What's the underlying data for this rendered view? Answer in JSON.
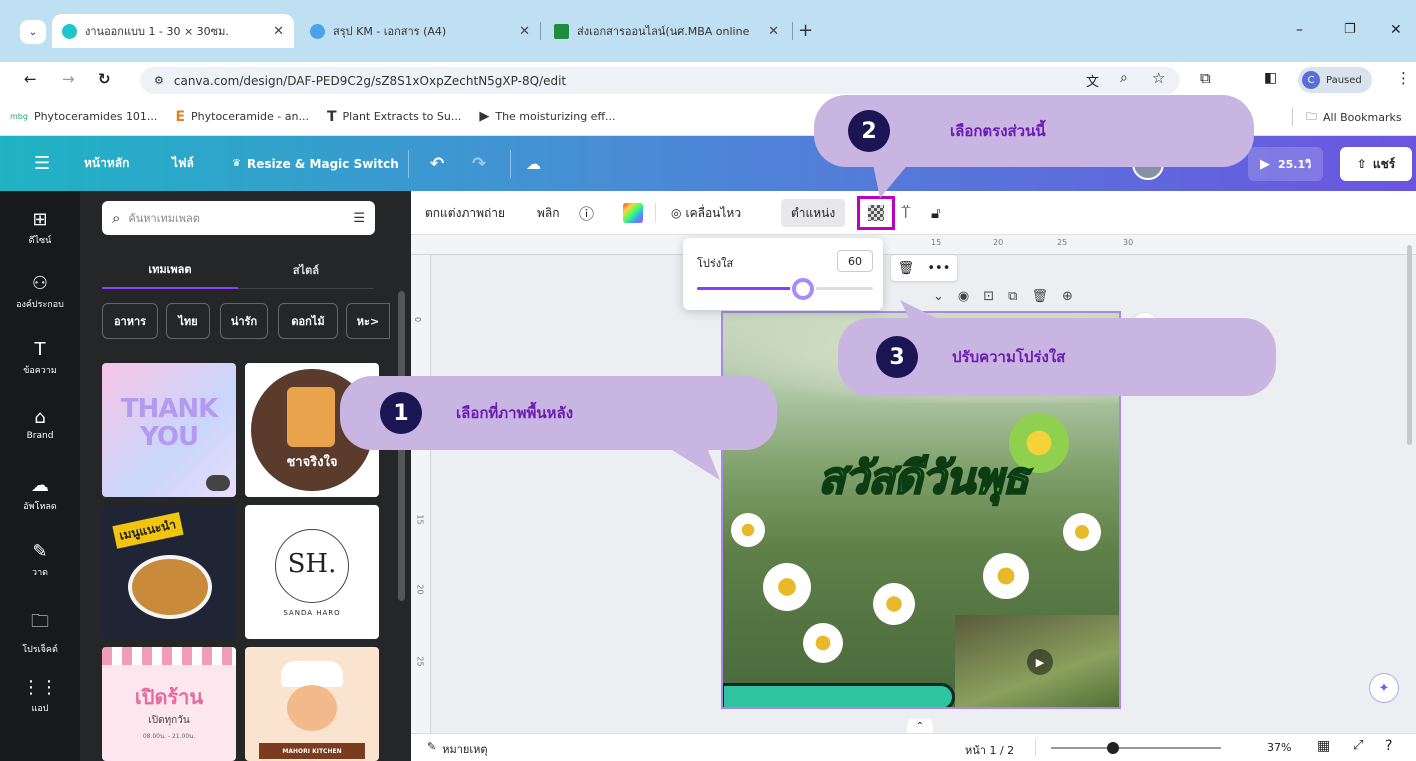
{
  "browser": {
    "tabs": [
      {
        "title": "งานออกแบบ 1 - 30 × 30ซม.",
        "active": true
      },
      {
        "title": "สรุป KM - เอกสาร (A4)",
        "active": false
      },
      {
        "title": "ส่งเอกสารออนไลน์(นศ.MBA online",
        "active": false
      }
    ],
    "url": "canva.com/design/DAF-PED9C2g/sZ8S1xOxpZechtN5gXP-8Q/edit",
    "profile_status": "Paused",
    "bookmarks": [
      "Phytoceramides 101...",
      "Phytoceramide - an...",
      "Plant Extracts to Su...",
      "The moisturizing eff..."
    ],
    "all_bookmarks": "All Bookmarks"
  },
  "canva_header": {
    "home": "หน้าหลัก",
    "file": "ไฟล์",
    "resize": "Resize & Magic Switch",
    "play_time": "25.1วิ",
    "share": "แชร์"
  },
  "rail": [
    {
      "label": "ดีไซน์",
      "icon": "layout-icon"
    },
    {
      "label": "องค์ประกอบ",
      "icon": "shapes-icon"
    },
    {
      "label": "ข้อความ",
      "icon": "text-icon"
    },
    {
      "label": "Brand",
      "icon": "brand-icon"
    },
    {
      "label": "อัพโหลด",
      "icon": "upload-icon"
    },
    {
      "label": "วาด",
      "icon": "draw-icon"
    },
    {
      "label": "โปรเจ็คต์",
      "icon": "folder-icon"
    },
    {
      "label": "แอป",
      "icon": "apps-icon"
    }
  ],
  "panel": {
    "search_placeholder": "ค้นหาเทมเพลต",
    "tabs": [
      "เทมเพลต",
      "สไตล์"
    ],
    "chips": [
      "อาหาร",
      "ไทย",
      "น่ารัก",
      "ดอกไม้",
      "หะ>"
    ],
    "templates": [
      {
        "text": "THANK YOU"
      },
      {
        "text": "ชาจริงใจ"
      },
      {
        "text": "เมนูแนะนำ"
      },
      {
        "text": "SH.",
        "sub": "SANDA HARO"
      },
      {
        "text": "เปิดร้าน",
        "sub": "เปิดทุกวัน",
        "sub2": "08.00น. - 21.00น."
      },
      {
        "text": "MAHORI KITCHEN"
      }
    ]
  },
  "toolbar": {
    "edit_photo": "ตกแต่งภาพถ่าย",
    "flip": "พลิก",
    "animate": "เคลื่อนไหว",
    "position": "ตำแหน่ง"
  },
  "transparency_popup": {
    "label": "โปร่งใส",
    "value": "60",
    "level_percent": 60
  },
  "ruler_marks": [
    "15",
    "20",
    "25",
    "30"
  ],
  "vruler_marks": [
    "0",
    "15",
    "20",
    "25"
  ],
  "canvas": {
    "headline": "สวัสดีวันพุธ"
  },
  "status": {
    "notes": "หมายเหตุ",
    "page": "หน้า 1 / 2",
    "zoom": "37%"
  },
  "callouts": [
    {
      "num": "1",
      "text": "เลือกที่ภาพพื้นหลัง"
    },
    {
      "num": "2",
      "text": "เลือกตรงส่วนนี้"
    },
    {
      "num": "3",
      "text": "ปรับความโปร่งใส"
    }
  ],
  "colors": {
    "callout_bg": "#c9b5e2",
    "callout_text": "#6a1db0",
    "badge": "#1b1553",
    "highlight": "#c000c0",
    "slider": "#8b3dff"
  }
}
